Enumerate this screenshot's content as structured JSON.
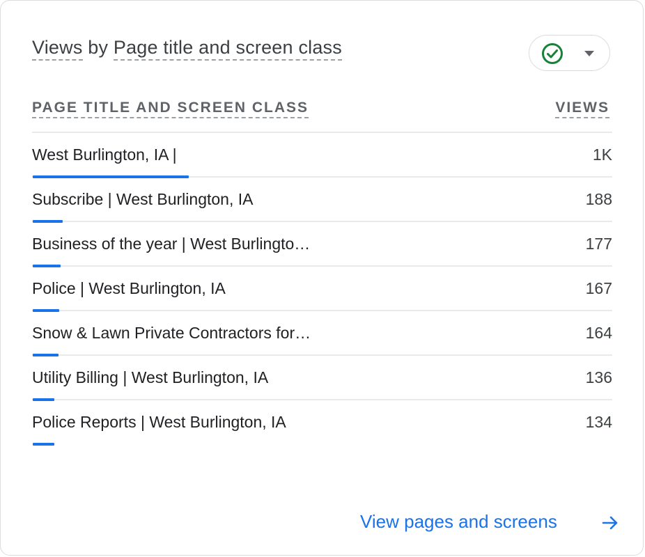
{
  "card": {
    "title_metric": "Views",
    "title_by": " by ",
    "title_dimension": "Page title and screen class"
  },
  "status": {
    "icon": "check-circle-icon",
    "dropdown_icon": "caret-down-icon",
    "color": "#188038"
  },
  "table": {
    "col_dimension": "PAGE TITLE AND SCREEN CLASS",
    "col_metric": "VIEWS",
    "bar_color": "#1a73e8",
    "rows": [
      {
        "label": "West Burlington, IA |",
        "value": "1K",
        "bar_fraction": 1.0
      },
      {
        "label": "Subscribe | West Burlington, IA",
        "value": "188",
        "bar_fraction": 0.19
      },
      {
        "label": "Business of the year | West Burlingto…",
        "value": "177",
        "bar_fraction": 0.18
      },
      {
        "label": "Police | West Burlington, IA",
        "value": "167",
        "bar_fraction": 0.17
      },
      {
        "label": "Snow & Lawn Private Contractors for…",
        "value": "164",
        "bar_fraction": 0.167
      },
      {
        "label": "Utility Billing | West Burlington, IA",
        "value": "136",
        "bar_fraction": 0.14
      },
      {
        "label": "Police Reports | West Burlington, IA",
        "value": "134",
        "bar_fraction": 0.137
      }
    ]
  },
  "footer": {
    "link_label": "View pages and screens",
    "link_icon": "arrow-right-icon",
    "accent": "#1a73e8"
  }
}
